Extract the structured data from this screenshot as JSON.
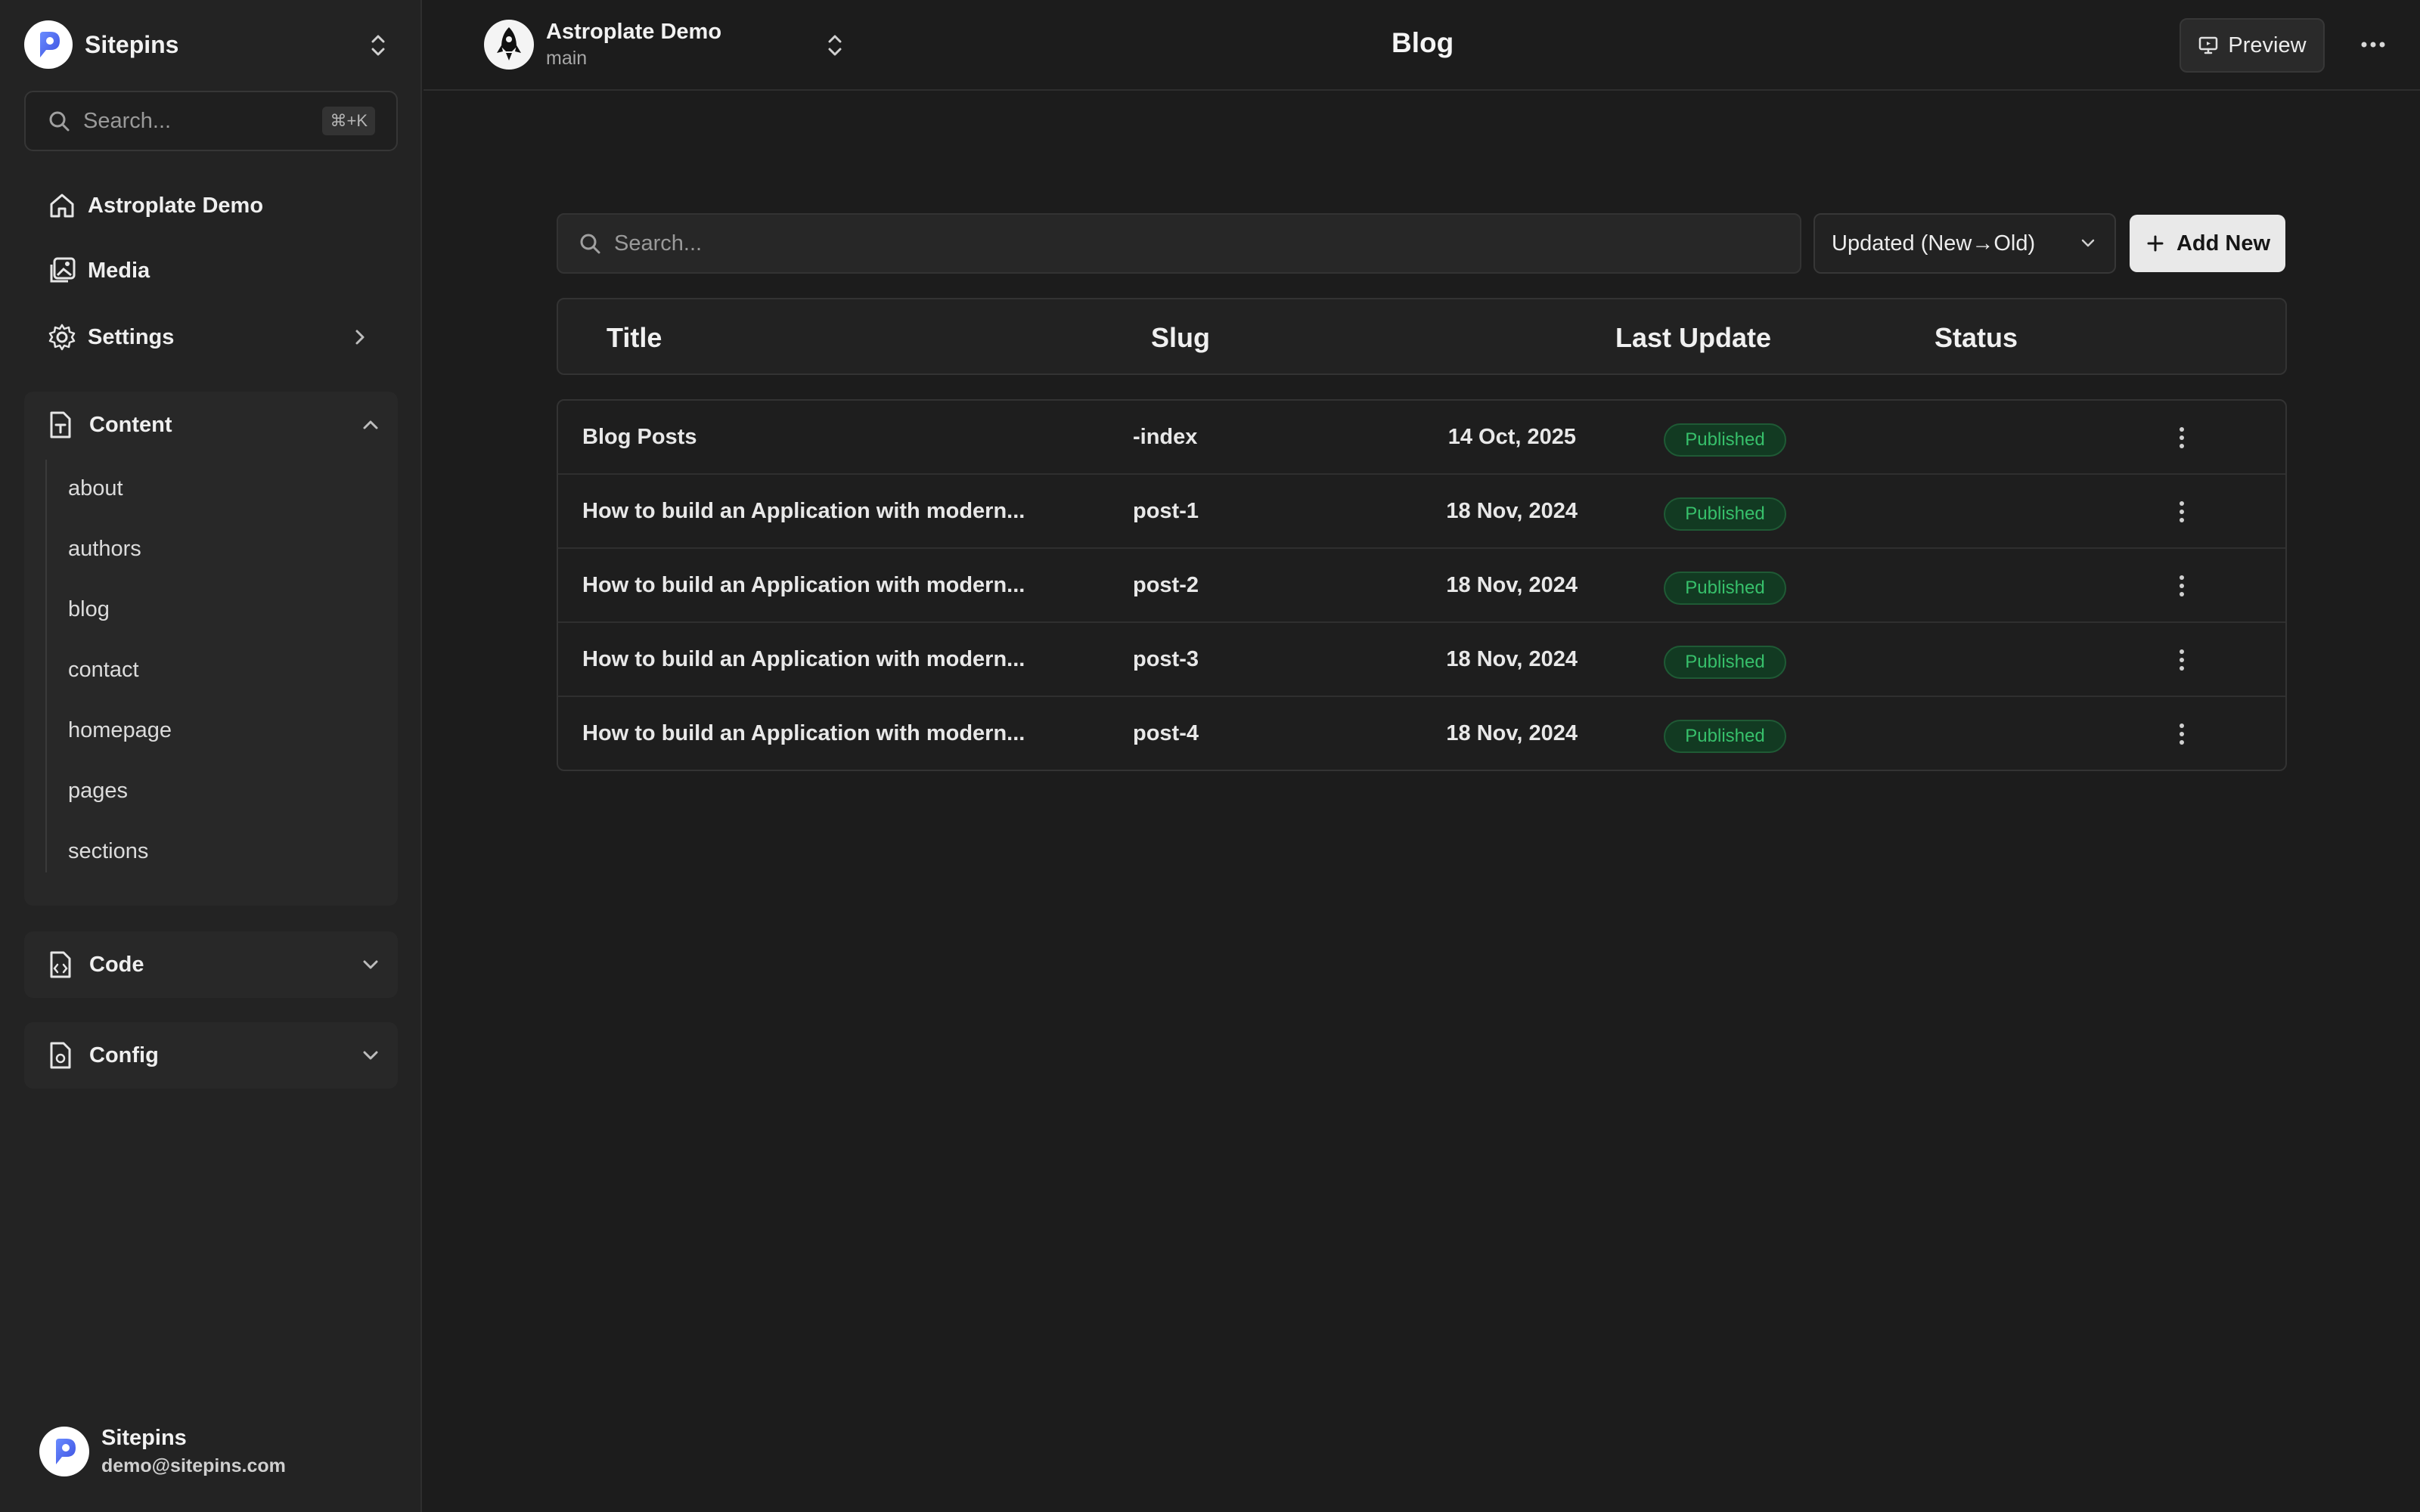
{
  "sidebar": {
    "brand": "Sitepins",
    "search_placeholder": "Search...",
    "search_shortcut": "⌘+K",
    "nav": [
      {
        "label": "Astroplate Demo",
        "icon": "home-icon"
      },
      {
        "label": "Media",
        "icon": "media-icon"
      },
      {
        "label": "Settings",
        "icon": "gear-icon"
      }
    ],
    "content_group": {
      "label": "Content",
      "items": [
        "about",
        "authors",
        "blog",
        "contact",
        "homepage",
        "pages",
        "sections"
      ]
    },
    "code_group": {
      "label": "Code"
    },
    "config_group": {
      "label": "Config"
    },
    "user": {
      "name": "Sitepins",
      "email": "demo@sitepins.com"
    }
  },
  "topbar": {
    "project_name": "Astroplate Demo",
    "branch": "main",
    "page_title": "Blog",
    "preview_label": "Preview"
  },
  "toolbar": {
    "search_placeholder": "Search...",
    "sort_label": "Updated (New→Old)",
    "add_label": "Add New"
  },
  "table": {
    "columns": [
      "Title",
      "Slug",
      "Last Update",
      "Status"
    ],
    "rows": [
      {
        "title": "Blog Posts",
        "slug": "-index",
        "updated": "14 Oct, 2025",
        "status": "Published"
      },
      {
        "title": "How to build an Application with modern...",
        "slug": "post-1",
        "updated": "18 Nov, 2024",
        "status": "Published"
      },
      {
        "title": "How to build an Application with modern...",
        "slug": "post-2",
        "updated": "18 Nov, 2024",
        "status": "Published"
      },
      {
        "title": "How to build an Application with modern...",
        "slug": "post-3",
        "updated": "18 Nov, 2024",
        "status": "Published"
      },
      {
        "title": "How to build an Application with modern...",
        "slug": "post-4",
        "updated": "18 Nov, 2024",
        "status": "Published"
      }
    ]
  },
  "colors": {
    "background": "#1c1c1c",
    "sidebar": "#232323",
    "badge_text": "#37c06b",
    "badge_bg": "#123a22",
    "brand_blue": "#4a6cf7"
  }
}
